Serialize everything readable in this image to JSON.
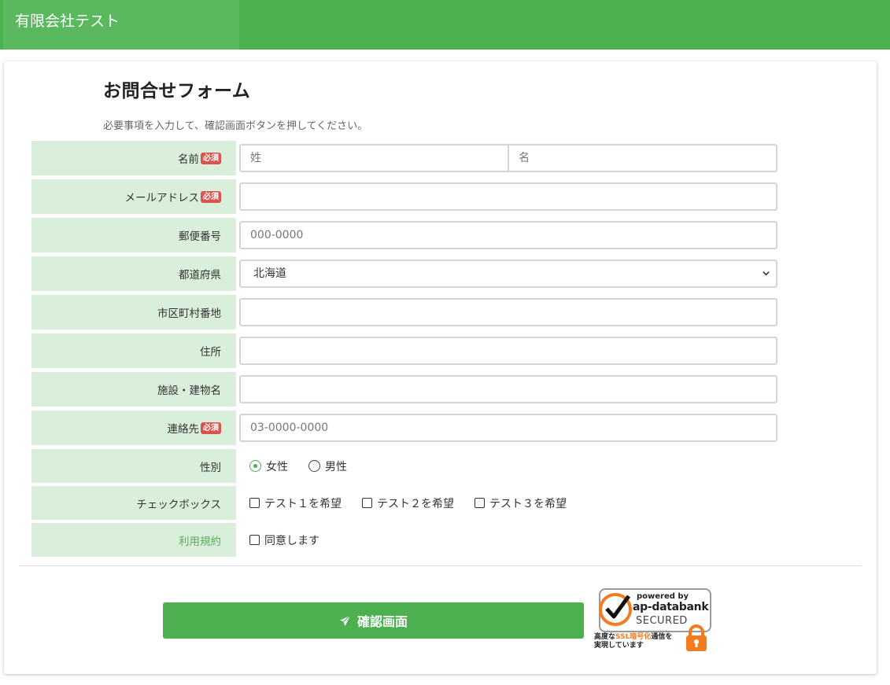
{
  "header": {
    "company": "有限会社テスト"
  },
  "form": {
    "title": "お問合せフォーム",
    "subtitle": "必要事項を入力して、確認画面ボタンを押してください。",
    "required_badge": "必須",
    "fields": {
      "name": {
        "label": "名前",
        "last_placeholder": "姓",
        "first_placeholder": "名"
      },
      "email": {
        "label": "メールアドレス",
        "value": ""
      },
      "postal": {
        "label": "郵便番号",
        "placeholder": "000-0000"
      },
      "prefecture": {
        "label": "都道府県",
        "selected": "北海道"
      },
      "city": {
        "label": "市区町村番地",
        "value": ""
      },
      "address": {
        "label": "住所",
        "value": ""
      },
      "building": {
        "label": "施設・建物名",
        "value": ""
      },
      "phone": {
        "label": "連絡先",
        "placeholder": "03-0000-0000"
      },
      "gender": {
        "label": "性別",
        "options": [
          "女性",
          "男性"
        ],
        "selected": "女性"
      },
      "checkbox": {
        "label": "チェックボックス",
        "options": [
          "テスト１を希望",
          "テスト２を希望",
          "テスト３を希望"
        ]
      },
      "terms": {
        "label": "利用規約",
        "option": "同意します"
      }
    },
    "submit_label": "確認画面"
  },
  "seal": {
    "powered": "powered by",
    "brand": "ap-databank",
    "secured": "SECURED",
    "note_prefix": "高度な",
    "note_ssl": "SSL暗号化",
    "note_suffix": "通信を",
    "note_line2": "実現しています"
  },
  "colors": {
    "accent": "#4caf50",
    "label_bg": "#d9eedb",
    "required": "#d9534f"
  }
}
